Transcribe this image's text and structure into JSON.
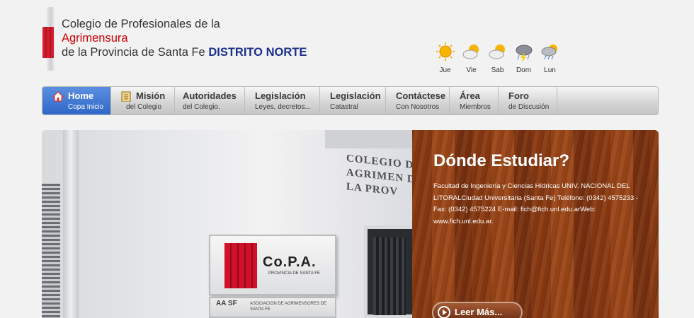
{
  "header": {
    "title_line1": "Colegio de Profesionales de la",
    "title_line2": "Agrimensura",
    "title_line3": "de la Provincia de Santa Fe",
    "title_district": "DISTRITO NORTE"
  },
  "weather": {
    "days": [
      {
        "label": "Jue",
        "icon": "sun-icon"
      },
      {
        "label": "Vie",
        "icon": "partly-cloudy-icon"
      },
      {
        "label": "Sab",
        "icon": "partly-cloudy-icon"
      },
      {
        "label": "Dom",
        "icon": "storm-icon"
      },
      {
        "label": "Lun",
        "icon": "rain-sun-icon"
      }
    ]
  },
  "nav": {
    "items": [
      {
        "title": "Home",
        "subtitle": "Copa Inicio",
        "icon": "home-icon"
      },
      {
        "title": "Misión",
        "subtitle": "del Colegio",
        "icon": "clipboard-icon"
      },
      {
        "title": "Autoridades",
        "subtitle": "del Colegio."
      },
      {
        "title": "Legislación",
        "subtitle": "Leyes, decretos..."
      },
      {
        "title": "Legislación",
        "subtitle": "Catastral"
      },
      {
        "title": "Contáctese",
        "subtitle": "Con Nosotros"
      },
      {
        "title": "Área",
        "subtitle": "Miembros"
      },
      {
        "title": "Foro",
        "subtitle": "de Discusión"
      }
    ]
  },
  "banner": {
    "heading": "Dónde Estudiar?",
    "body": "Facultad de Ingeniería y Ciencias Hídricas UNIV. NACIONAL DEL LITORALCiudad Universitaria (Santa Fe) Teléfono: (0342) 4575233 - Fax: (0342) 4575224 E-mail: fich@fich.unl.edu.arWeb: www.fich.unl.edu.ar.",
    "button_label": "Leer Más...",
    "photo": {
      "sign_text": "COLEGIO DE AGRIMEN DE LA PROV",
      "plaque_logo": "Co.P.A.",
      "plaque_sub": "PROVINCIA DE SANTA FE",
      "plaque2_letters": "AA SF",
      "plaque2_text": "ASOCIACION DE AGRIMENSORES DE SANTA FE"
    }
  },
  "colors": {
    "accent_blue": "#2f67c8",
    "brand_red": "#cc0000",
    "district_blue": "#1a2f8c",
    "wood": "#8b3d14"
  }
}
